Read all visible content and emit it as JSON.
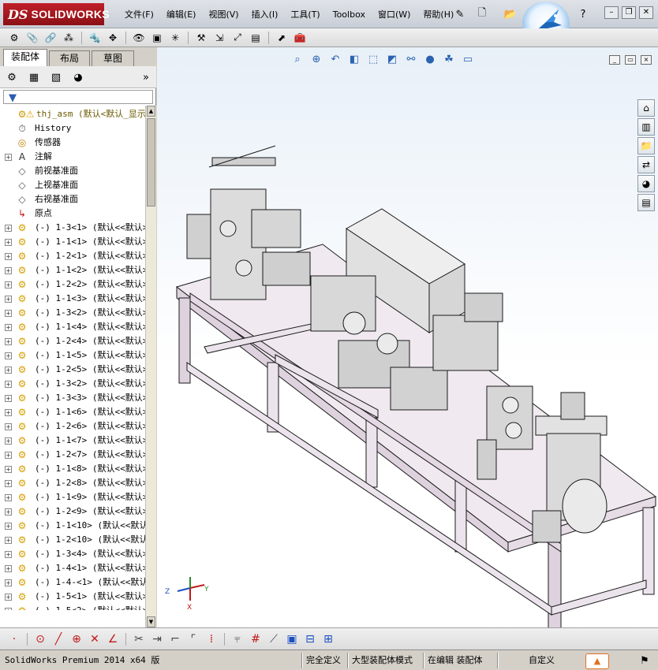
{
  "app": {
    "logo_ds": "DS",
    "logo_name": "SOLIDWORKS",
    "menus": [
      "文件(F)",
      "编辑(E)",
      "视图(V)",
      "插入(I)",
      "工具(T)",
      "Toolbox",
      "窗口(W)",
      "帮助(H)"
    ],
    "help_icon": "?"
  },
  "panel": {
    "tabs": [
      "装配体",
      "布局",
      "草图"
    ],
    "expand_label": "»",
    "tree": [
      {
        "icon": "assembly-icon",
        "warn": true,
        "label": "thj_asm  (默认<默认_显示"
      },
      {
        "icon": "history-icon",
        "label": "History"
      },
      {
        "icon": "sensor-icon",
        "label": "传感器"
      },
      {
        "icon": "annotation-icon",
        "label": "注解"
      },
      {
        "icon": "plane-icon",
        "label": "前视基准面"
      },
      {
        "icon": "plane-icon",
        "label": "上视基准面"
      },
      {
        "icon": "plane-icon",
        "label": "右视基准面"
      },
      {
        "icon": "origin-icon",
        "label": "原点"
      },
      {
        "icon": "part-icon",
        "label": "(-) 1-3<1> (默认<<默认>"
      },
      {
        "icon": "part-icon",
        "label": "(-) 1-1<1> (默认<<默认>"
      },
      {
        "icon": "part-icon",
        "label": "(-) 1-2<1> (默认<<默认>"
      },
      {
        "icon": "part-icon",
        "label": "(-) 1-1<2> (默认<<默认>"
      },
      {
        "icon": "part-icon",
        "label": "(-) 1-2<2> (默认<<默认>"
      },
      {
        "icon": "part-icon",
        "label": "(-) 1-1<3> (默认<<默认>"
      },
      {
        "icon": "part-icon",
        "label": "(-) 1-3<2> (默认<<默认>"
      },
      {
        "icon": "part-icon",
        "label": "(-) 1-1<4> (默认<<默认>"
      },
      {
        "icon": "part-icon",
        "label": "(-) 1-2<4> (默认<<默认>"
      },
      {
        "icon": "part-icon",
        "label": "(-) 1-1<5> (默认<<默认>"
      },
      {
        "icon": "part-icon",
        "label": "(-) 1-2<5> (默认<<默认>"
      },
      {
        "icon": "part-icon",
        "label": "(-) 1-3<2> (默认<<默认>"
      },
      {
        "icon": "part-icon",
        "label": "(-) 1-3<3> (默认<<默认>"
      },
      {
        "icon": "part-icon",
        "label": "(-) 1-1<6> (默认<<默认>"
      },
      {
        "icon": "part-icon",
        "label": "(-) 1-2<6> (默认<<默认>"
      },
      {
        "icon": "part-icon",
        "label": "(-) 1-1<7> (默认<<默认>"
      },
      {
        "icon": "part-icon",
        "label": "(-) 1-2<7> (默认<<默认>"
      },
      {
        "icon": "part-icon",
        "label": "(-) 1-1<8> (默认<<默认>"
      },
      {
        "icon": "part-icon",
        "label": "(-) 1-2<8> (默认<<默认>"
      },
      {
        "icon": "part-icon",
        "label": "(-) 1-1<9> (默认<<默认>"
      },
      {
        "icon": "part-icon",
        "label": "(-) 1-2<9> (默认<<默认>"
      },
      {
        "icon": "part-icon",
        "label": "(-) 1-1<10> (默认<<默认"
      },
      {
        "icon": "part-icon",
        "label": "(-) 1-2<10> (默认<<默认"
      },
      {
        "icon": "part-icon",
        "label": "(-) 1-3<4> (默认<<默认>"
      },
      {
        "icon": "part-icon",
        "label": "(-) 1-4<1> (默认<<默认>"
      },
      {
        "icon": "part-icon",
        "label": "(-) 1-4-<1> (默认<<默认"
      },
      {
        "icon": "part-icon",
        "label": "(-) 1-5<1> (默认<<默认>"
      },
      {
        "icon": "part-icon",
        "label": "(-) 1-5<2> (默认<<默认>"
      }
    ]
  },
  "triad": {
    "z": "Z",
    "y": "Y",
    "x": "X"
  },
  "status": {
    "app": "SolidWorks Premium 2014 x64 版",
    "state": "完全定义",
    "mode": "大型装配体模式",
    "editing": "在编辑 装配体",
    "units": "自定义"
  },
  "colors": {
    "brand": "#a8141c",
    "frame": "#e8e0e8"
  }
}
